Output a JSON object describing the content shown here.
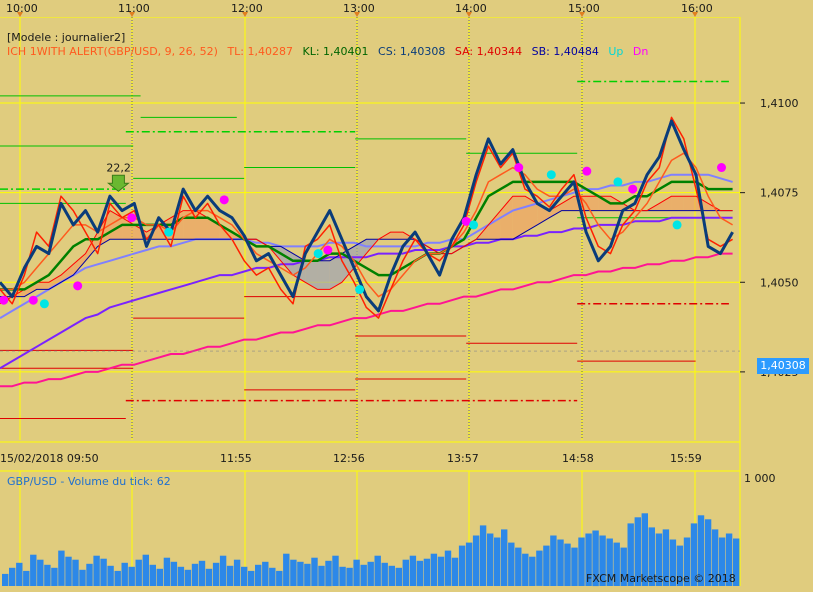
{
  "header": {
    "model_label": "[Modele : journalier2]"
  },
  "indicator_legend": {
    "name": "ICH 1WITH ALERT(GBP/USD, 9, 26, 52)",
    "tl": "TL: 1,40287",
    "kl": "KL: 1,40401",
    "cs": "CS: 1,40308",
    "sa": "SA: 1,40344",
    "sb": "SB: 1,40484",
    "up": "Up",
    "dn": "Dn"
  },
  "volume_panel": {
    "label": "GBP/USD - Volume du tick: 62",
    "max_label": "1 000"
  },
  "current_price_tag": "1,40308",
  "footer": {
    "copyright": "FXCM Marketscope © 2018"
  },
  "annotation": "22,2",
  "colors": {
    "background": "#e0cc7e",
    "grid": "#ffff00",
    "price": "#ff2000",
    "close_line": "#0a3c7a",
    "tenkan": "#ff5a1e",
    "kijun": "#008000",
    "senkou_a": "#ff0000",
    "senkou_b": "#0000a0",
    "ma_fast": "#8080ff",
    "ma_mid": "#7a22ff",
    "ma_slow": "#ff1493",
    "volume": "#2c88e8",
    "signal_up": "#00e5e5",
    "signal_dn": "#ff00ff"
  },
  "chart_data": {
    "type": "line",
    "symbol": "GBP/USD",
    "top_time_labels": [
      "10:00",
      "11:00",
      "12:00",
      "13:00",
      "14:00",
      "15:00",
      "16:00"
    ],
    "bottom_time_labels": [
      "15/02/2018 09:50",
      "11:55",
      "12:56",
      "13:57",
      "14:58",
      "15:59"
    ],
    "y_tick_labels": [
      "1,4100",
      "1,4075",
      "1,4050",
      "1,4025"
    ],
    "ylim": [
      1.4006,
      1.4124
    ],
    "current_price": 1.40308,
    "series": [
      {
        "key": "close",
        "values": [
          1.405,
          1.4046,
          1.4054,
          1.406,
          1.4058,
          1.4072,
          1.4066,
          1.407,
          1.4064,
          1.4074,
          1.407,
          1.4072,
          1.406,
          1.4068,
          1.4064,
          1.4076,
          1.407,
          1.4074,
          1.407,
          1.4068,
          1.4063,
          1.4056,
          1.4058,
          1.4052,
          1.4046,
          1.4058,
          1.4064,
          1.407,
          1.4062,
          1.4054,
          1.4046,
          1.4042,
          1.4052,
          1.406,
          1.4064,
          1.4058,
          1.4052,
          1.4062,
          1.4068,
          1.408,
          1.409,
          1.4083,
          1.4087,
          1.4078,
          1.4072,
          1.407,
          1.4074,
          1.4078,
          1.4064,
          1.4056,
          1.406,
          1.407,
          1.4072,
          1.408,
          1.4085,
          1.4095,
          1.4087,
          1.408,
          1.406,
          1.4058,
          1.4064
        ]
      },
      {
        "key": "price",
        "values": [
          1.4048,
          1.4044,
          1.4052,
          1.4064,
          1.406,
          1.4074,
          1.407,
          1.4064,
          1.4058,
          1.4072,
          1.4068,
          1.407,
          1.4062,
          1.4066,
          1.406,
          1.4074,
          1.4068,
          1.4072,
          1.4066,
          1.4062,
          1.4056,
          1.4052,
          1.4054,
          1.4048,
          1.4044,
          1.406,
          1.4062,
          1.4066,
          1.4056,
          1.405,
          1.4043,
          1.404,
          1.4048,
          1.4056,
          1.4062,
          1.4058,
          1.4056,
          1.406,
          1.4066,
          1.4078,
          1.4088,
          1.4082,
          1.4086,
          1.4076,
          1.4074,
          1.4071,
          1.4076,
          1.408,
          1.4068,
          1.406,
          1.4058,
          1.4066,
          1.407,
          1.4078,
          1.4082,
          1.4096,
          1.409,
          1.4076,
          1.4062,
          1.406,
          1.4062
        ]
      },
      {
        "key": "tenkan",
        "values": [
          1.4048,
          1.4048,
          1.405,
          1.4054,
          1.4058,
          1.4062,
          1.4066,
          1.4066,
          1.4064,
          1.4066,
          1.4068,
          1.4068,
          1.4066,
          1.4066,
          1.4064,
          1.4068,
          1.407,
          1.407,
          1.4068,
          1.4066,
          1.4062,
          1.4058,
          1.4056,
          1.4054,
          1.4052,
          1.4054,
          1.4058,
          1.4062,
          1.406,
          1.4056,
          1.405,
          1.4046,
          1.4048,
          1.4052,
          1.4056,
          1.4058,
          1.4058,
          1.406,
          1.4064,
          1.407,
          1.4078,
          1.408,
          1.4082,
          1.408,
          1.4076,
          1.4074,
          1.4074,
          1.4076,
          1.4072,
          1.4066,
          1.4062,
          1.4064,
          1.4068,
          1.4072,
          1.4078,
          1.4084,
          1.4086,
          1.4082,
          1.4074,
          1.4068,
          1.4066
        ]
      },
      {
        "key": "kijun",
        "values": [
          1.4048,
          1.4048,
          1.4048,
          1.405,
          1.4052,
          1.4056,
          1.406,
          1.4062,
          1.4062,
          1.4064,
          1.4066,
          1.4066,
          1.4066,
          1.4066,
          1.4066,
          1.4068,
          1.4068,
          1.4068,
          1.4066,
          1.4064,
          1.4062,
          1.406,
          1.406,
          1.4058,
          1.4056,
          1.4056,
          1.4056,
          1.4058,
          1.4058,
          1.4056,
          1.4054,
          1.4052,
          1.4052,
          1.4054,
          1.4056,
          1.4058,
          1.4058,
          1.406,
          1.4062,
          1.4068,
          1.4074,
          1.4076,
          1.4078,
          1.4078,
          1.4078,
          1.4078,
          1.4078,
          1.4078,
          1.4076,
          1.4074,
          1.4072,
          1.4072,
          1.4074,
          1.4074,
          1.4076,
          1.4078,
          1.4078,
          1.4078,
          1.4076,
          1.4076,
          1.4076
        ]
      },
      {
        "key": "ma_fast",
        "values": [
          1.404,
          1.4042,
          1.4044,
          1.4046,
          1.4048,
          1.405,
          1.4052,
          1.4054,
          1.4055,
          1.4056,
          1.4057,
          1.4058,
          1.4059,
          1.406,
          1.406,
          1.4061,
          1.4062,
          1.4062,
          1.4062,
          1.4062,
          1.4062,
          1.4061,
          1.4061,
          1.406,
          1.406,
          1.406,
          1.406,
          1.4061,
          1.4061,
          1.4061,
          1.406,
          1.406,
          1.406,
          1.406,
          1.406,
          1.4061,
          1.4061,
          1.4062,
          1.4062,
          1.4064,
          1.4066,
          1.4068,
          1.407,
          1.4071,
          1.4072,
          1.4073,
          1.4074,
          1.4075,
          1.4076,
          1.4076,
          1.4077,
          1.4077,
          1.4078,
          1.4078,
          1.4079,
          1.408,
          1.408,
          1.408,
          1.408,
          1.4079,
          1.4078
        ]
      },
      {
        "key": "ma_mid",
        "values": [
          1.4026,
          1.4028,
          1.403,
          1.4032,
          1.4034,
          1.4036,
          1.4038,
          1.404,
          1.4041,
          1.4043,
          1.4044,
          1.4045,
          1.4046,
          1.4047,
          1.4048,
          1.4049,
          1.405,
          1.4051,
          1.4052,
          1.4052,
          1.4053,
          1.4054,
          1.4054,
          1.4055,
          1.4055,
          1.4056,
          1.4056,
          1.4057,
          1.4057,
          1.4057,
          1.4057,
          1.4058,
          1.4058,
          1.4058,
          1.4059,
          1.4059,
          1.4059,
          1.406,
          1.406,
          1.4061,
          1.4061,
          1.4062,
          1.4062,
          1.4063,
          1.4063,
          1.4064,
          1.4064,
          1.4065,
          1.4065,
          1.4066,
          1.4066,
          1.4066,
          1.4067,
          1.4067,
          1.4067,
          1.4068,
          1.4068,
          1.4068,
          1.4068,
          1.4068,
          1.4068
        ]
      },
      {
        "key": "ma_slow",
        "values": [
          1.4021,
          1.4021,
          1.4022,
          1.4022,
          1.4023,
          1.4023,
          1.4024,
          1.4025,
          1.4025,
          1.4026,
          1.4027,
          1.4027,
          1.4028,
          1.4029,
          1.403,
          1.403,
          1.4031,
          1.4032,
          1.4032,
          1.4033,
          1.4034,
          1.4034,
          1.4035,
          1.4036,
          1.4036,
          1.4037,
          1.4038,
          1.4038,
          1.4039,
          1.404,
          1.404,
          1.4041,
          1.4042,
          1.4042,
          1.4043,
          1.4044,
          1.4044,
          1.4045,
          1.4046,
          1.4046,
          1.4047,
          1.4048,
          1.4048,
          1.4049,
          1.405,
          1.405,
          1.4051,
          1.4052,
          1.4052,
          1.4053,
          1.4053,
          1.4054,
          1.4054,
          1.4055,
          1.4055,
          1.4056,
          1.4056,
          1.4057,
          1.4057,
          1.4058,
          1.4058
        ]
      },
      {
        "key": "senkou_a",
        "values": [
          1.4044,
          1.4046,
          1.4048,
          1.405,
          1.405,
          1.4052,
          1.4055,
          1.4058,
          1.4064,
          1.407,
          1.4068,
          1.4066,
          1.4064,
          1.4066,
          1.4068,
          1.407,
          1.407,
          1.4068,
          1.4066,
          1.4064,
          1.4062,
          1.4062,
          1.406,
          1.4056,
          1.4052,
          1.405,
          1.4048,
          1.4048,
          1.405,
          1.4054,
          1.4058,
          1.4062,
          1.4064,
          1.4064,
          1.4062,
          1.406,
          1.4058,
          1.4058,
          1.406,
          1.4062,
          1.4066,
          1.407,
          1.4074,
          1.4074,
          1.4072,
          1.407,
          1.4072,
          1.4074,
          1.4074,
          1.4074,
          1.4074,
          1.4072,
          1.407,
          1.407,
          1.4072,
          1.4074,
          1.4074,
          1.4074,
          1.4072,
          1.407,
          1.407
        ]
      },
      {
        "key": "senkou_b",
        "values": [
          1.4046,
          1.4046,
          1.4046,
          1.4048,
          1.4048,
          1.405,
          1.4052,
          1.4056,
          1.406,
          1.4062,
          1.4062,
          1.4062,
          1.4062,
          1.4062,
          1.4062,
          1.4062,
          1.4062,
          1.4062,
          1.4062,
          1.4062,
          1.4062,
          1.4062,
          1.406,
          1.406,
          1.4058,
          1.4056,
          1.4056,
          1.4056,
          1.4058,
          1.406,
          1.4062,
          1.4062,
          1.4062,
          1.4062,
          1.4062,
          1.406,
          1.4058,
          1.4058,
          1.406,
          1.4062,
          1.4062,
          1.4062,
          1.4062,
          1.4064,
          1.4066,
          1.4068,
          1.407,
          1.407,
          1.407,
          1.407,
          1.407,
          1.407,
          1.407,
          1.407,
          1.407,
          1.407,
          1.407,
          1.407,
          1.407,
          1.407,
          1.407
        ]
      }
    ],
    "horizontal_levels": [
      {
        "price": 1.4106,
        "style": "dashdot",
        "color": "#00d000",
        "span": [
          0.78,
          0.985
        ]
      },
      {
        "price": 1.4102,
        "style": "solid",
        "color": "#00c000",
        "span": [
          0.0,
          0.19
        ]
      },
      {
        "price": 1.4096,
        "style": "solid",
        "color": "#00c000",
        "span": [
          0.19,
          0.32
        ]
      },
      {
        "price": 1.4092,
        "style": "dashdot",
        "color": "#00d000",
        "span": [
          0.17,
          0.48
        ]
      },
      {
        "price": 1.409,
        "style": "solid",
        "color": "#00c000",
        "span": [
          0.48,
          0.63
        ]
      },
      {
        "price": 1.4088,
        "style": "solid",
        "color": "#00c000",
        "span": [
          0.0,
          0.18
        ]
      },
      {
        "price": 1.4086,
        "style": "solid",
        "color": "#00c000",
        "span": [
          0.63,
          0.78
        ]
      },
      {
        "price": 1.4082,
        "style": "solid",
        "color": "#00c000",
        "span": [
          0.33,
          0.48
        ]
      },
      {
        "price": 1.4079,
        "style": "solid",
        "color": "#00c000",
        "span": [
          0.18,
          0.33
        ]
      },
      {
        "price": 1.4076,
        "style": "dashdot",
        "color": "#00d000",
        "span": [
          0.0,
          0.17
        ]
      },
      {
        "price": 1.4072,
        "style": "solid",
        "color": "#00c000",
        "span": [
          0.0,
          0.17
        ]
      },
      {
        "price": 1.4068,
        "style": "solid",
        "color": "#00c000",
        "span": [
          0.78,
          0.94
        ]
      },
      {
        "price": 1.4044,
        "style": "dashdot",
        "color": "#e00000",
        "span": [
          0.78,
          0.985
        ]
      },
      {
        "price": 1.4046,
        "style": "solid",
        "color": "#e00000",
        "span": [
          0.33,
          0.48
        ]
      },
      {
        "price": 1.404,
        "style": "solid",
        "color": "#e00000",
        "span": [
          0.18,
          0.33
        ]
      },
      {
        "price": 1.4035,
        "style": "solid",
        "color": "#e00000",
        "span": [
          0.48,
          0.63
        ]
      },
      {
        "price": 1.4033,
        "style": "solid",
        "color": "#e00000",
        "span": [
          0.63,
          0.78
        ]
      },
      {
        "price": 1.4031,
        "style": "solid",
        "color": "#e00000",
        "span": [
          0.0,
          0.18
        ]
      },
      {
        "price": 1.4028,
        "style": "solid",
        "color": "#e00000",
        "span": [
          0.78,
          0.94
        ]
      },
      {
        "price": 1.4026,
        "style": "solid",
        "color": "#e00000",
        "span": [
          0.0,
          0.18
        ]
      },
      {
        "price": 1.4023,
        "style": "solid",
        "color": "#e00000",
        "span": [
          0.48,
          0.63
        ]
      },
      {
        "price": 1.402,
        "style": "solid",
        "color": "#e00000",
        "span": [
          0.33,
          0.48
        ]
      },
      {
        "price": 1.4017,
        "style": "dashdot",
        "color": "#e00000",
        "span": [
          0.17,
          0.78
        ]
      },
      {
        "price": 1.4012,
        "style": "solid",
        "color": "#e00000",
        "span": [
          0.0,
          0.17
        ]
      }
    ],
    "signals": [
      {
        "x": 0.005,
        "price": 1.4045,
        "type": "dn"
      },
      {
        "x": 0.045,
        "price": 1.4045,
        "type": "dn"
      },
      {
        "x": 0.06,
        "price": 1.4044,
        "type": "up"
      },
      {
        "x": 0.105,
        "price": 1.4049,
        "type": "dn"
      },
      {
        "x": 0.178,
        "price": 1.4068,
        "type": "dn"
      },
      {
        "x": 0.228,
        "price": 1.4064,
        "type": "up"
      },
      {
        "x": 0.303,
        "price": 1.4073,
        "type": "dn"
      },
      {
        "x": 0.43,
        "price": 1.4058,
        "type": "up"
      },
      {
        "x": 0.443,
        "price": 1.4059,
        "type": "dn"
      },
      {
        "x": 0.486,
        "price": 1.4048,
        "type": "up"
      },
      {
        "x": 0.63,
        "price": 1.4067,
        "type": "dn"
      },
      {
        "x": 0.64,
        "price": 1.4066,
        "type": "up"
      },
      {
        "x": 0.701,
        "price": 1.4082,
        "type": "dn"
      },
      {
        "x": 0.745,
        "price": 1.408,
        "type": "up"
      },
      {
        "x": 0.793,
        "price": 1.4081,
        "type": "dn"
      },
      {
        "x": 0.835,
        "price": 1.4078,
        "type": "up"
      },
      {
        "x": 0.855,
        "price": 1.4076,
        "type": "dn"
      },
      {
        "x": 0.915,
        "price": 1.4066,
        "type": "up"
      },
      {
        "x": 0.975,
        "price": 1.4082,
        "type": "dn"
      }
    ],
    "volume_ylim": [
      0,
      1000
    ],
    "volume": [
      120,
      180,
      230,
      150,
      310,
      260,
      210,
      180,
      350,
      290,
      260,
      160,
      220,
      300,
      270,
      200,
      150,
      230,
      190,
      260,
      310,
      210,
      170,
      280,
      240,
      190,
      160,
      220,
      250,
      170,
      230,
      300,
      200,
      260,
      190,
      150,
      210,
      240,
      180,
      150,
      320,
      260,
      240,
      220,
      280,
      200,
      250,
      300,
      190,
      180,
      260,
      210,
      240,
      300,
      230,
      200,
      180,
      260,
      300,
      250,
      270,
      320,
      290,
      350,
      280,
      400,
      430,
      500,
      600,
      520,
      480,
      560,
      430,
      380,
      320,
      290,
      350,
      400,
      500,
      460,
      420,
      380,
      480,
      520,
      550,
      500,
      470,
      430,
      380,
      620,
      680,
      720,
      580,
      520,
      560,
      460,
      400,
      480,
      620,
      700,
      660,
      560,
      480,
      520,
      470
    ]
  }
}
